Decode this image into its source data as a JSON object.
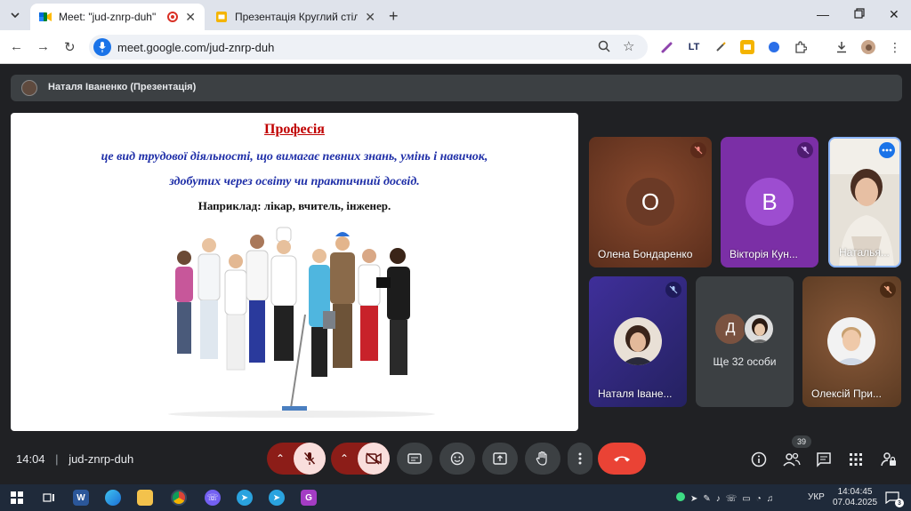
{
  "browser": {
    "tabs": [
      {
        "title": "Meet: \"jud-znrp-duh\"",
        "active": true,
        "icon": "google-meet-icon"
      },
      {
        "title": "Презентація Круглий стіл «Мо",
        "active": false,
        "icon": "google-slides-icon"
      }
    ],
    "url": "meet.google.com/jud-znrp-duh"
  },
  "meet": {
    "presenter": "Наталя Іваненко (Презентація)",
    "slide": {
      "title": "Професія",
      "line1": "це вид трудової діяльності, що вимагає певних знань, умінь і навичок,",
      "line2": "здобутих через освіту чи практичний досвід.",
      "example": "Наприклад:  лікар, вчитель, інженер."
    },
    "participants": [
      {
        "name": "Олена Бондаренко",
        "letter": "О",
        "muted": true
      },
      {
        "name": "Вікторія Кун...",
        "letter": "В",
        "muted": true
      },
      {
        "name": "Наталья...",
        "muted": false
      },
      {
        "name": "Наталя Іване...",
        "muted": true
      },
      {
        "name": "Олексій При...",
        "muted": true
      }
    ],
    "others": {
      "label": "Ще 32 особи",
      "letter": "Д"
    },
    "time": "14:04",
    "meeting_code": "jud-znrp-duh",
    "people_count": "39"
  },
  "taskbar": {
    "lang": "УКР",
    "time": "14:04:45",
    "date": "07.04.2025",
    "notifications": "3"
  },
  "colors": {
    "accent_blue": "#1a73e8",
    "danger_red": "#ea4335",
    "meet_bg": "#202124"
  }
}
